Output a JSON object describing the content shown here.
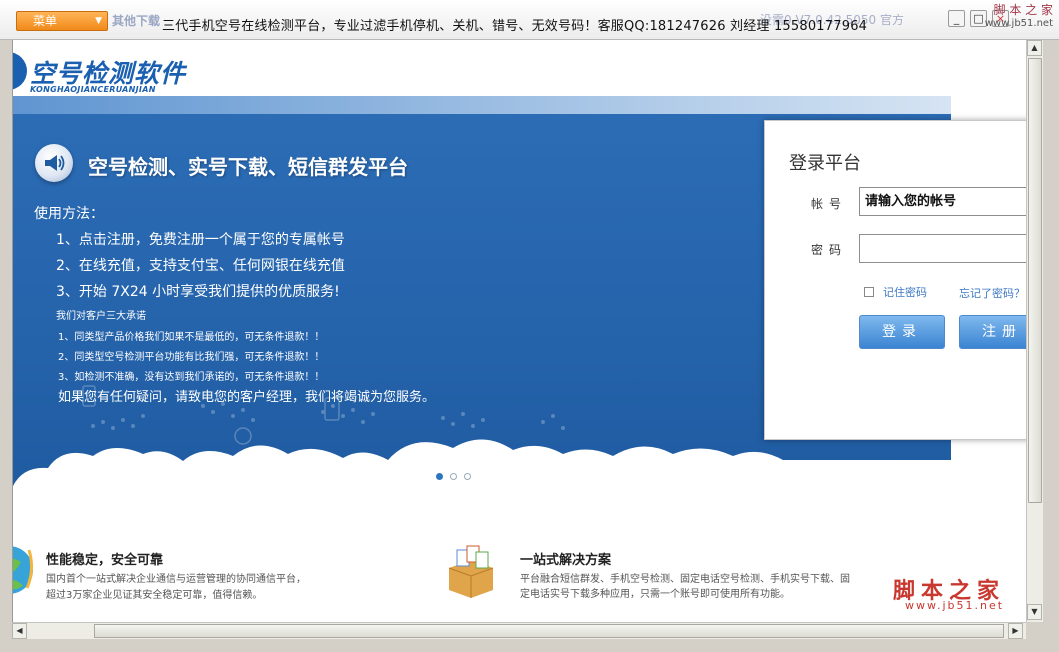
{
  "titlebar": {
    "menu_label": "菜单",
    "ghost_left": "其他下载",
    "title": "三代手机空号在线检测平台，专业过滤手机停机、关机、错号、无效号码！客服QQ:181247626    刘经理 15580177964",
    "ghost_right": "没需0 V7.0.42.5050 官方",
    "minimize": "_",
    "restore": "□",
    "close": "×",
    "watermark": "脚 本 之 家",
    "watermark_url": "www.jb51.net"
  },
  "logo": {
    "text": "空号检测软件",
    "sub": "KONGHAOJIANCERUANJIAN"
  },
  "banner": {
    "heading": "空号检测、实号下载、短信群发平台",
    "usage_title": "使用方法：",
    "steps": [
      "1、点击注册，免费注册一个属于您的专属帐号",
      "2、在线充值，支持支付宝、任何网银在线充值",
      "3、开始 7X24 小时享受我们提供的优质服务!"
    ],
    "promise_title": "我们对客户三大承诺",
    "promises": [
      "1、同类型产品价格我们如果不是最低的，可无条件退款！！",
      "2、同类型空号检测平台功能有比我们强，可无条件退款！！",
      "3、如检测不准确，没有达到我们承诺的，可无条件退款！！"
    ],
    "contact": "如果您有任何疑问，请致电您的客户经理，我们将竭诚为您服务。"
  },
  "login": {
    "title": "登录平台",
    "account_label": "帐号",
    "account_value": "请输入您的帐号",
    "password_label": "密码",
    "password_value": "",
    "remember_label": "记住密码",
    "forgot_label": "忘记了密码？",
    "login_button": "登录",
    "register_button": "注册"
  },
  "features": [
    {
      "title": "性能稳定，安全可靠",
      "desc1": "国内首个一站式解决企业通信与运营管理的协同通信平台，",
      "desc2": "超过3万家企业见证其安全稳定可靠，值得信赖。",
      "icon": "globe-icon"
    },
    {
      "title": "一站式解决方案",
      "desc1": "平台融合短信群发、手机空号检测、固定电话空号检测、手机实号下载、固",
      "desc2": "定电话实号下载多种应用，只需一个账号即可使用所有功能。",
      "icon": "box-icon"
    }
  ],
  "watermark": {
    "text": "脚本之家",
    "url": "www.jb51.net"
  },
  "slider": {
    "count": 3,
    "active": 0
  },
  "colors": {
    "banner_blue": "#2766ae",
    "accent_orange": "#f08a1a",
    "link_blue": "#3c78c5",
    "button_blue": "#3b84d2"
  }
}
